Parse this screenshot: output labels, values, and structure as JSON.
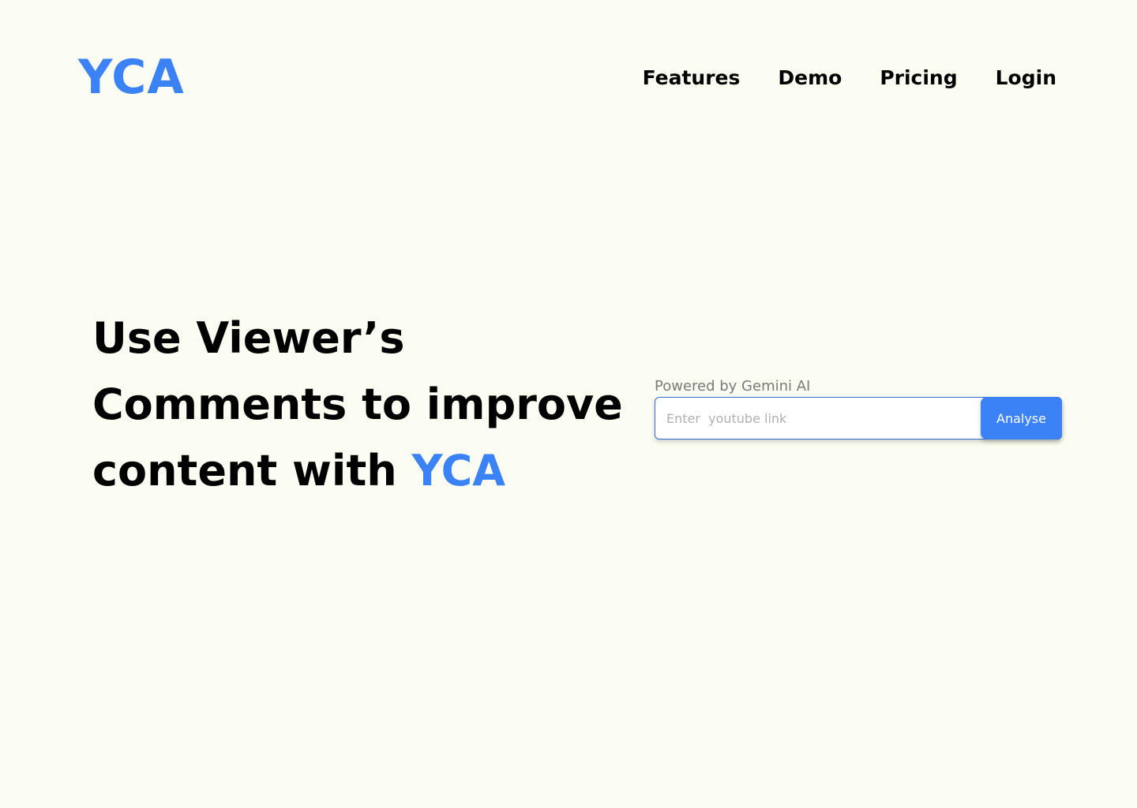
{
  "header": {
    "logo": "YCA",
    "nav": [
      {
        "label": "Features"
      },
      {
        "label": "Demo"
      },
      {
        "label": "Pricing"
      },
      {
        "label": "Login"
      }
    ]
  },
  "hero": {
    "title_line1": "Use Viewer’s",
    "title_line2": "Comments to improve",
    "title_line3_prefix": "content with ",
    "title_line3_accent": "YCA"
  },
  "analyse_form": {
    "powered_by": "Powered by Gemini AI",
    "input_value": "",
    "input_placeholder": "Enter  youtube link",
    "button_label": "Analyse"
  },
  "colors": {
    "background": "#fbfdf2",
    "accent": "#3b82f6",
    "text": "#000000",
    "muted_text": "#7a7a7a"
  }
}
